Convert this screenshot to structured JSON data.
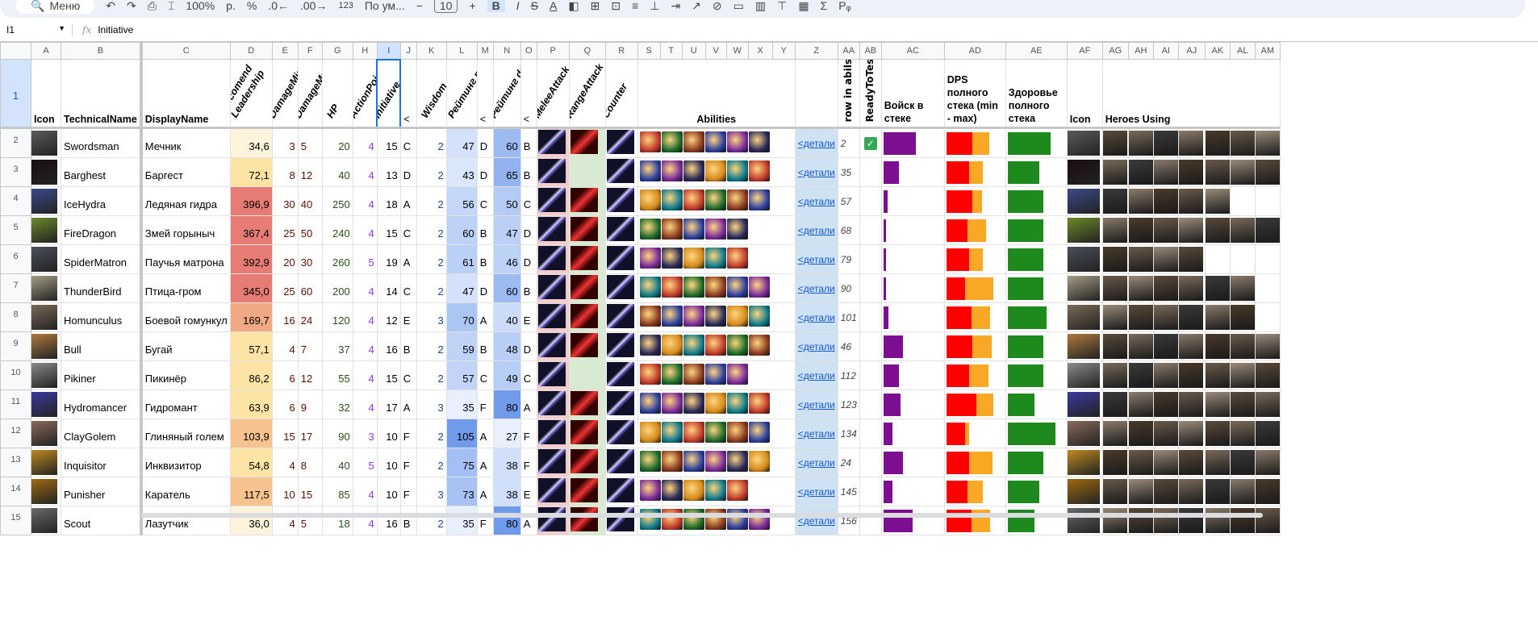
{
  "toolbar": {
    "search": "Меню",
    "zoom": "100%",
    "currency": "р.",
    "percent": "%",
    "dec_minus": ".0←",
    "dec_plus": ".00→",
    "format123": "123",
    "font": "По ум...",
    "minus": "−",
    "font_size": "10",
    "plus": "+",
    "bold": "B",
    "italic": "I",
    "strike": "S",
    "text_color": "A",
    "sum": "Σ",
    "close": "×"
  },
  "formula": {
    "cell": "I1",
    "fx": "fx",
    "value": "Initiative"
  },
  "columns": [
    "A",
    "B",
    "C",
    "D",
    "E",
    "F",
    "G",
    "H",
    "I",
    "J",
    "K",
    "L",
    "M",
    "N",
    "O",
    "P",
    "Q",
    "R",
    "S",
    "T",
    "U",
    "V",
    "W",
    "X",
    "Y",
    "Z",
    "AA",
    "AB",
    "AC",
    "AD",
    "AE",
    "AF",
    "AG",
    "AH",
    "AI",
    "AJ",
    "AK",
    "AL",
    "AM"
  ],
  "headers": {
    "icon": "Icon",
    "technical": "TechnicalName",
    "display": "DisplayName",
    "leadership": "Recomend Leadership",
    "dmin": "DamageMin",
    "dmax": "DamageMax",
    "hp": "HP",
    "ap": "ActionPoints",
    "init": "Initiative",
    "lt1": "<",
    "wisdom": "Wisdom",
    "tank": "Рейтинг танка",
    "lt2": "<",
    "dd": "Рейтинг dd",
    "lt3": "<",
    "melee": "MeleeAttack",
    "range": "RangeAttack",
    "counter": "Counter",
    "abilities": "Abilities",
    "row_abils": "row in abils",
    "ready": "ReadyToTest",
    "troops": "Войск в стеке",
    "dps": "DPS полного стека (min - max)",
    "health": "Здоровье полного стека",
    "icon2": "Icon",
    "heroes": "Heroes Using"
  },
  "colors": {
    "troops": "#7b0f8f",
    "dps_min": "#ff0000",
    "dps_max": "#f9a825",
    "health": "#1e8a1e",
    "link_bg": "#cfe2f3"
  },
  "rows": [
    {
      "n": "2",
      "tech": "Swordsman",
      "disp": "Мечник",
      "lead": "34,6",
      "dmin": "3",
      "dmax": "5",
      "hp": "20",
      "ap": "4",
      "init": "15",
      "ig": "C",
      "wis": "2",
      "tank": "47",
      "tg": "D",
      "dd": "60",
      "dg": "B",
      "link": "<детали",
      "ra": "2",
      "ready": true,
      "troops": 0.55,
      "dps": [
        0.45,
        0.3
      ],
      "health": 0.75,
      "abil": 6,
      "heroes": 7,
      "q": "icon",
      "icon": "#5a5a5a"
    },
    {
      "n": "3",
      "tech": "Barghest",
      "disp": "Баргест",
      "lead": "72,1",
      "dmin": "8",
      "dmax": "12",
      "hp": "40",
      "ap": "4",
      "init": "13",
      "ig": "D",
      "wis": "2",
      "tank": "43",
      "tg": "D",
      "dd": "65",
      "dg": "B",
      "link": "<детали",
      "ra": "35",
      "ready": false,
      "troops": 0.27,
      "dps": [
        0.4,
        0.23
      ],
      "health": 0.55,
      "abil": 6,
      "heroes": 7,
      "q": "empty",
      "icon": "#1a0d12"
    },
    {
      "n": "4",
      "tech": "IceHydra",
      "disp": "Ледяная гидра",
      "lead": "396,9",
      "dmin": "30",
      "dmax": "40",
      "hp": "250",
      "ap": "4",
      "init": "18",
      "ig": "A",
      "wis": "2",
      "tank": "56",
      "tg": "C",
      "dd": "50",
      "dg": "C",
      "link": "<детали",
      "ra": "57",
      "ready": false,
      "troops": 0.07,
      "dps": [
        0.46,
        0.16
      ],
      "health": 0.62,
      "abil": 6,
      "heroes": 5,
      "q": "icon",
      "icon": "#3b4a8c"
    },
    {
      "n": "5",
      "tech": "FireDragon",
      "disp": "Змей горыныч",
      "lead": "367,4",
      "dmin": "25",
      "dmax": "50",
      "hp": "240",
      "ap": "4",
      "init": "15",
      "ig": "C",
      "wis": "2",
      "tank": "60",
      "tg": "B",
      "dd": "47",
      "dg": "D",
      "link": "<детали",
      "ra": "68",
      "ready": false,
      "troops": 0.05,
      "dps": [
        0.37,
        0.33
      ],
      "health": 0.62,
      "abil": 5,
      "heroes": 7,
      "q": "icon",
      "icon": "#6c8a2a"
    },
    {
      "n": "6",
      "tech": "SpiderMatron",
      "disp": "Паучья матрона",
      "lead": "392,9",
      "dmin": "20",
      "dmax": "30",
      "hp": "260",
      "ap": "5",
      "init": "19",
      "ig": "A",
      "wis": "2",
      "tank": "61",
      "tg": "B",
      "dd": "46",
      "dg": "D",
      "link": "<детали",
      "ra": "79",
      "ready": false,
      "troops": 0.05,
      "dps": [
        0.4,
        0.23
      ],
      "health": 0.62,
      "abil": 5,
      "heroes": 4,
      "q": "icon",
      "icon": "#4b4f5a"
    },
    {
      "n": "7",
      "tech": "ThunderBird",
      "disp": "Птица-гром",
      "lead": "345,0",
      "dmin": "25",
      "dmax": "60",
      "hp": "200",
      "ap": "4",
      "init": "14",
      "ig": "C",
      "wis": "2",
      "tank": "47",
      "tg": "D",
      "dd": "60",
      "dg": "B",
      "link": "<детали",
      "ra": "90",
      "ready": false,
      "troops": 0.05,
      "dps": [
        0.33,
        0.49
      ],
      "health": 0.62,
      "abil": 6,
      "heroes": 6,
      "q": "icon",
      "icon": "#a59d86"
    },
    {
      "n": "8",
      "tech": "Homunculus",
      "disp": "Боевой гомункул",
      "lead": "169,7",
      "dmin": "16",
      "dmax": "24",
      "hp": "120",
      "ap": "4",
      "init": "12",
      "ig": "E",
      "wis": "3",
      "tank": "70",
      "tg": "A",
      "dd": "40",
      "dg": "E",
      "link": "<детали",
      "ra": "101",
      "ready": false,
      "troops": 0.09,
      "dps": [
        0.44,
        0.33
      ],
      "health": 0.68,
      "abil": 6,
      "heroes": 6,
      "q": "icon",
      "icon": "#7a6a55"
    },
    {
      "n": "9",
      "tech": "Bull",
      "disp": "Бугай",
      "lead": "57,1",
      "dmin": "4",
      "dmax": "7",
      "hp": "37",
      "ap": "4",
      "init": "16",
      "ig": "B",
      "wis": "2",
      "tank": "59",
      "tg": "B",
      "dd": "48",
      "dg": "D",
      "link": "<детали",
      "ra": "46",
      "ready": false,
      "troops": 0.33,
      "dps": [
        0.46,
        0.33
      ],
      "health": 0.62,
      "abil": 6,
      "heroes": 7,
      "q": "icon",
      "icon": "#b07a40"
    },
    {
      "n": "10",
      "tech": "Pikiner",
      "disp": "Пикинёр",
      "lead": "86,2",
      "dmin": "6",
      "dmax": "12",
      "hp": "55",
      "ap": "4",
      "init": "15",
      "ig": "C",
      "wis": "2",
      "tank": "57",
      "tg": "C",
      "dd": "49",
      "dg": "C",
      "link": "<детали",
      "ra": "112",
      "ready": false,
      "troops": 0.27,
      "dps": [
        0.4,
        0.33
      ],
      "health": 0.62,
      "abil": 5,
      "heroes": 7,
      "q": "empty",
      "icon": "#8a8a8a"
    },
    {
      "n": "11",
      "tech": "Hydromancer",
      "disp": "Гидромант",
      "lead": "63,9",
      "dmin": "6",
      "dmax": "9",
      "hp": "32",
      "ap": "4",
      "init": "17",
      "ig": "A",
      "wis": "3",
      "tank": "35",
      "tg": "F",
      "dd": "80",
      "dg": "A",
      "link": "<детали",
      "ra": "123",
      "ready": false,
      "troops": 0.29,
      "dps": [
        0.53,
        0.29
      ],
      "health": 0.47,
      "abil": 6,
      "heroes": 7,
      "q": "icon",
      "icon": "#3a3aa0"
    },
    {
      "n": "12",
      "tech": "ClayGolem",
      "disp": "Глиняный голем",
      "lead": "103,9",
      "dmin": "15",
      "dmax": "17",
      "hp": "90",
      "ap": "3",
      "init": "10",
      "ig": "F",
      "wis": "2",
      "tank": "105",
      "tg": "A",
      "dd": "27",
      "dg": "F",
      "link": "<детали",
      "ra": "134",
      "ready": false,
      "troops": 0.16,
      "dps": [
        0.33,
        0.07
      ],
      "health": 0.83,
      "abil": 6,
      "heroes": 7,
      "q": "icon",
      "icon": "#8a6a5a"
    },
    {
      "n": "13",
      "tech": "Inquisitor",
      "disp": "Инквизитор",
      "lead": "54,8",
      "dmin": "4",
      "dmax": "8",
      "hp": "40",
      "ap": "5",
      "init": "10",
      "ig": "F",
      "wis": "2",
      "tank": "75",
      "tg": "A",
      "dd": "38",
      "dg": "F",
      "link": "<детали",
      "ra": "24",
      "ready": false,
      "troops": 0.33,
      "dps": [
        0.4,
        0.4
      ],
      "health": 0.62,
      "abil": 6,
      "heroes": 7,
      "q": "icon",
      "icon": "#c08a20"
    },
    {
      "n": "14",
      "tech": "Punisher",
      "disp": "Каратель",
      "lead": "117,5",
      "dmin": "10",
      "dmax": "15",
      "hp": "85",
      "ap": "4",
      "init": "10",
      "ig": "F",
      "wis": "3",
      "tank": "73",
      "tg": "A",
      "dd": "38",
      "dg": "E",
      "link": "<детали",
      "ra": "145",
      "ready": false,
      "troops": 0.16,
      "dps": [
        0.37,
        0.27
      ],
      "health": 0.55,
      "abil": 5,
      "heroes": 7,
      "q": "icon",
      "icon": "#a06a10"
    },
    {
      "n": "15",
      "tech": "Scout",
      "disp": "Лазутчик",
      "lead": "36,0",
      "dmin": "4",
      "dmax": "5",
      "hp": "18",
      "ap": "4",
      "init": "16",
      "ig": "B",
      "wis": "2",
      "tank": "35",
      "tg": "F",
      "dd": "80",
      "dg": "A",
      "link": "<детали",
      "ra": "156",
      "ready": false,
      "troops": 0.5,
      "dps": [
        0.44,
        0.33
      ],
      "health": 0.47,
      "abil": 6,
      "heroes": 7,
      "q": "icon",
      "icon": "#6a6a6a"
    }
  ]
}
